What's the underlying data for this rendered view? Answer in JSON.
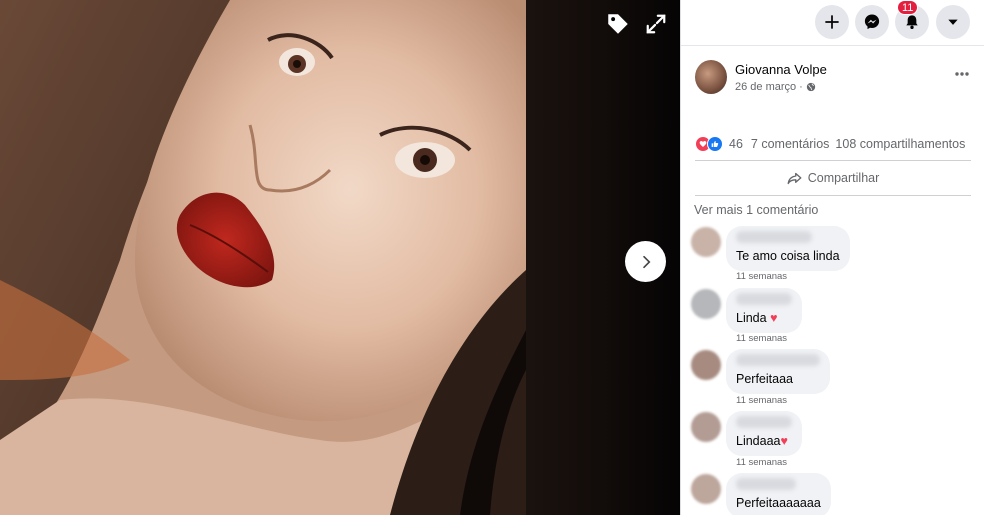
{
  "viewer": {
    "tag_icon": "tag-icon",
    "expand_icon": "expand-icon",
    "next_icon": "chevron-right-icon"
  },
  "topbar": {
    "create_icon": "plus-icon",
    "messenger_icon": "messenger-icon",
    "notifications_icon": "bell-icon",
    "notifications_badge": "11",
    "account_icon": "caret-down-icon"
  },
  "post": {
    "author": "Giovanna Volpe",
    "date": "26 de março",
    "privacy_icon": "globe-icon",
    "more_icon": "more-horizontal-icon",
    "reaction_count": "46",
    "comments": "7 comentários",
    "shares": "108 compartilhamentos",
    "share_label": "Compartilhar",
    "view_more_comments": "Ver mais 1 comentário"
  },
  "comments": [
    {
      "text": "Te amo coisa linda",
      "time": "11 semanas"
    },
    {
      "text": "Linda ♥",
      "time": "11 semanas"
    },
    {
      "text": "Perfeitaaa",
      "time": "11 semanas"
    },
    {
      "text": "Lindaaa♥",
      "time": "11 semanas"
    },
    {
      "text": "Perfeitaaaaaaa",
      "time": ""
    }
  ],
  "colors": {
    "fb_blue": "#1877f2",
    "love_red": "#f33e58",
    "badge_red": "#e41e3f",
    "muted_text": "#65676b",
    "bubble_bg": "#f0f2f5"
  }
}
